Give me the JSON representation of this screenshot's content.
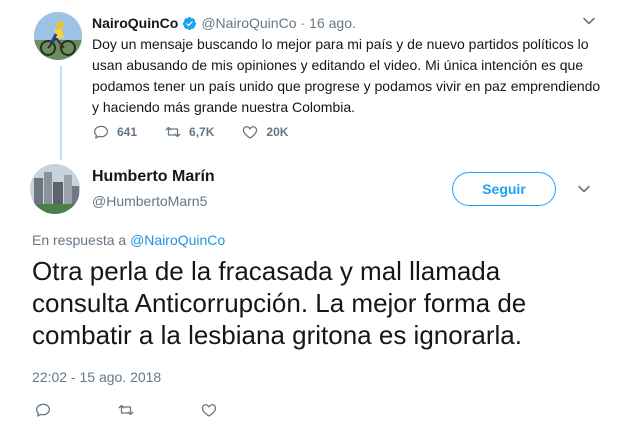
{
  "parent_tweet": {
    "display_name": "NairoQuinCo",
    "handle": "@NairoQuinCo",
    "separator": "·",
    "timestamp": "16 ago.",
    "text": "Doy un mensaje buscando lo mejor para mi país y de nuevo partidos políticos lo usan abusando de mis opiniones y editando el video. Mi única intención es que podamos tener un país unido que progrese y podamos vivir en paz emprendiendo y haciendo más grande nuestra Colombia.",
    "reply_count": "641",
    "retweet_count": "6,7K",
    "like_count": "20K",
    "verified": true
  },
  "main_tweet": {
    "display_name": "Humberto Marín",
    "handle": "@HumbertoMarn5",
    "follow_label": "Seguir",
    "reply_prefix": "En respuesta a",
    "reply_to": "@NairoQuinCo",
    "text": "Otra perla de la fracasada y mal llamada consulta Anticorrupción. La mejor forma de combatir a la lesbiana gritona es ignorarla.",
    "timestamp": "22:02 - 15 ago. 2018"
  },
  "colors": {
    "accent": "#1da1f2",
    "link": "#1b95e0",
    "muted": "#657786",
    "text": "#14171a",
    "thread_line": "#c4dcee"
  },
  "icons": [
    "reply-icon",
    "retweet-icon",
    "like-icon",
    "chevron-down-icon",
    "verified-badge-icon"
  ]
}
